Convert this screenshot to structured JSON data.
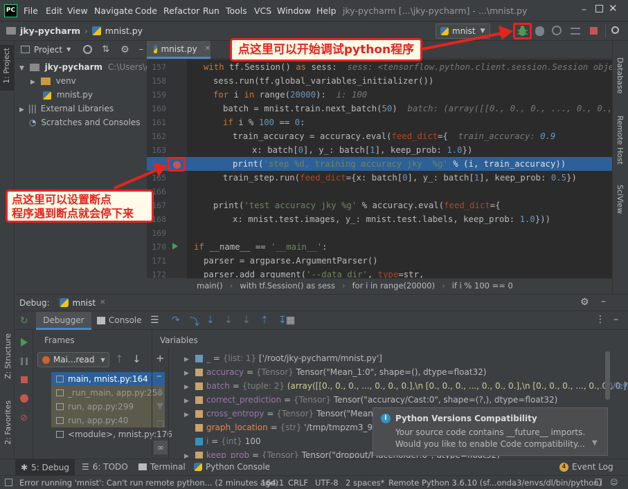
{
  "menubar": {
    "logo": "PC",
    "items": [
      "File",
      "Edit",
      "View",
      "Navigate",
      "Code",
      "Refactor",
      "Run",
      "Tools",
      "VCS",
      "Window",
      "Help"
    ],
    "title": "jky-pycharm [...\\jky-pycharm] - ...\\mnist.py"
  },
  "navbar": {
    "project": "jky-pycharm",
    "file": "mnist.py",
    "run_config": "mnist"
  },
  "project_panel": {
    "header": "Project",
    "root_name": "jky-pycharm",
    "root_path": "C:\\Users\\guox",
    "items": [
      "venv",
      "mnist.py",
      "External Libraries",
      "Scratches and Consoles"
    ]
  },
  "left_tabs": {
    "project": "1: Project",
    "structure": "Z: Structure",
    "favorites": "2: Favorites"
  },
  "right_tabs": [
    "Database",
    "Remote Host",
    "SciView"
  ],
  "editor": {
    "tab": "mnist.py",
    "lines": [
      {
        "n": "157",
        "text": "with tf.Session() as sess:  sess: <tensorflow.python.client.session.Session object a"
      },
      {
        "n": "158",
        "text": "sess.run(tf.global_variables_initializer())"
      },
      {
        "n": "159",
        "text": "for i in range(20000):  i: 100"
      },
      {
        "n": "160",
        "text": "batch = mnist.train.next_batch(50)  batch: (array([[0., 0., 0., ..., 0., 0., 0.]"
      },
      {
        "n": "161",
        "text": "if i % 100 == 0:"
      },
      {
        "n": "162",
        "text": "train_accuracy = accuracy.eval(feed_dict={  train_accuracy: 0.9"
      },
      {
        "n": "163",
        "text": "x: batch[0], y_: batch[1], keep_prob: 1.0})"
      },
      {
        "n": "164",
        "text": "print('step %d, training accuracy jky  %g' % (i, train_accuracy))"
      },
      {
        "n": "165",
        "text": "train_step.run(feed_dict={x: batch[0], y_: batch[1], keep_prob: 0.5})"
      },
      {
        "n": "166",
        "text": ""
      },
      {
        "n": "167",
        "text": "print('test accuracy jky %g' % accuracy.eval(feed_dict={"
      },
      {
        "n": "168",
        "text": "x: mnist.test.images, y_: mnist.test.labels, keep_prob: 1.0}))"
      },
      {
        "n": "169",
        "text": ""
      },
      {
        "n": "170",
        "text": "if __name__ == '__main__':"
      },
      {
        "n": "171",
        "text": "parser = argparse.ArgumentParser()"
      },
      {
        "n": "172",
        "text": "parser.add_argument('--data_dir', type=str,"
      }
    ],
    "breadcrumb": [
      "main()",
      "with tf.Session() as sess",
      "for i in range(20000)",
      "if i % 100 == 0"
    ]
  },
  "debug_panel": {
    "title": "Debug:",
    "config": "mnist",
    "tabs": [
      "Debugger",
      "Console"
    ],
    "frames_header": "Frames",
    "variables_header": "Variables",
    "thread": "Mai...read",
    "frames": [
      "main, mnist.py:164",
      "_run_main, app.py:250",
      "run, app.py:299",
      "run, app.py:40",
      "<module>, mnist.py:176"
    ],
    "variables": [
      {
        "name": "_",
        "type": "{list: 1}",
        "value": "['/root/jky-pycharm/mnist.py']"
      },
      {
        "name": "accuracy",
        "type": "{Tensor}",
        "value": "Tensor(\"Mean_1:0\", shape=(), dtype=float32)"
      },
      {
        "name": "batch",
        "type": "{tuple: 2}",
        "value": "(array([[0., 0., 0., ..., 0., 0., 0.],\\n       [0., 0., 0., ..., 0., 0., 0.],\\n       [0., 0., 0., ..., 0., 0., 0.]\\n",
        "extra": "... View"
      },
      {
        "name": "correct_prediction",
        "type": "{Tensor}",
        "value": "Tensor(\"accuracy/Cast:0\", shape=(?,), dtype=float32)"
      },
      {
        "name": "cross_entropy",
        "type": "{Tensor}",
        "value": "Tensor(\"Mean:0\", shape"
      },
      {
        "name": "graph_location",
        "type": "{str}",
        "value": "'/tmp/tmpzm3_9raf'"
      },
      {
        "name": "i",
        "type": "{int}",
        "value": "100"
      },
      {
        "name": "keep_prob",
        "type": "{Tensor}",
        "value": "Tensor(\"dropout/Placeholder:0\", dtype=float32)"
      }
    ]
  },
  "notification": {
    "title": "Python Versions Compatibility",
    "body1": "Your source code contains __future__ imports.",
    "body2": "Would you like to enable Code compatibility..."
  },
  "bottom_tabs": [
    "5: Debug",
    "6: TODO",
    "Terminal",
    "Python Console"
  ],
  "event_log": {
    "count": "4",
    "label": "Event Log"
  },
  "statusbar": {
    "message": "Error running 'mnist': Can't run remote python... (2 minutes ago)",
    "position": "164:1",
    "line_sep": "CRLF",
    "encoding": "UTF-8",
    "indent": "2 spaces*",
    "interpreter": "Remote Python 3.6.10 (sf...onda3/envs/dl/bin/python)"
  },
  "annotations": {
    "debug_hint": "点这里可以开始调试python程序",
    "breakpoint_hint_line1": "点这里可以设置断点",
    "breakpoint_hint_line2": "程序遇到断点就会停下来"
  },
  "colors": {
    "background": "#3c3f41",
    "editor_bg": "#2b2b2b",
    "current_line": "#2d6099",
    "breakpoint": "#c75450",
    "annotation_red": "#e8231e",
    "run_green": "#499c54"
  }
}
